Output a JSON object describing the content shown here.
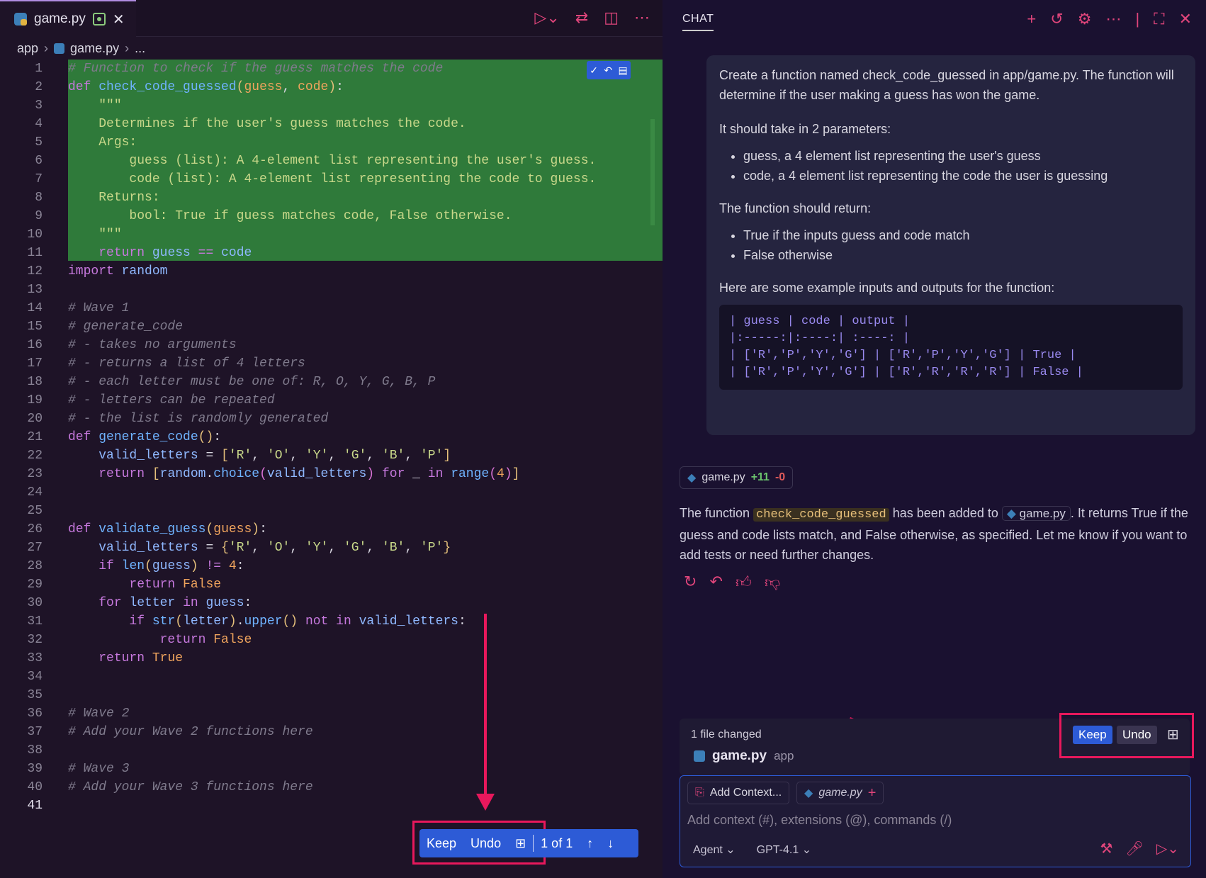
{
  "editor": {
    "tab_label": "game.py",
    "breadcrumb": [
      "app",
      "game.py",
      "..."
    ],
    "lines": [
      {
        "n": "1",
        "html": "<span class='cm'># Function to check if the guess matches the code</span>"
      },
      {
        "n": "2",
        "html": "<span class='kw'>def</span> <span class='fn'>check_code_guessed</span><span class='br'>(</span><span class='par'>guess</span>, <span class='par'>code</span><span class='br'>)</span>:"
      },
      {
        "n": "3",
        "html": "    <span class='doc'>\"\"\"</span>"
      },
      {
        "n": "4",
        "html": "    <span class='doc'>Determines if the user's guess matches the code.</span>"
      },
      {
        "n": "5",
        "html": "    <span class='doc'>Args:</span>"
      },
      {
        "n": "6",
        "html": "        <span class='doc'>guess (list): A 4-element list representing the user's guess.</span>"
      },
      {
        "n": "7",
        "html": "        <span class='doc'>code (list): A 4-element list representing the code to guess.</span>"
      },
      {
        "n": "8",
        "html": "    <span class='doc'>Returns:</span>"
      },
      {
        "n": "9",
        "html": "        <span class='doc'>bool: True if guess matches code, False otherwise.</span>"
      },
      {
        "n": "10",
        "html": "    <span class='doc'>\"\"\"</span>"
      },
      {
        "n": "11",
        "html": "    <span class='kw'>return</span> <span class='ident'>guess</span> <span class='kw'>==</span> <span class='ident'>code</span>"
      },
      {
        "n": "12",
        "html": "<span class='kw'>import</span> <span class='ident'>random</span>"
      },
      {
        "n": "13",
        "html": ""
      },
      {
        "n": "14",
        "html": "<span class='cm'># Wave 1</span>"
      },
      {
        "n": "15",
        "html": "<span class='cm'># generate_code</span>"
      },
      {
        "n": "16",
        "html": "<span class='cm'># - takes no arguments</span>"
      },
      {
        "n": "17",
        "html": "<span class='cm'># - returns a list of 4 letters</span>"
      },
      {
        "n": "18",
        "html": "<span class='cm'># - each letter must be one of: R, O, Y, G, B, P</span>"
      },
      {
        "n": "19",
        "html": "<span class='cm'># - letters can be repeated</span>"
      },
      {
        "n": "20",
        "html": "<span class='cm'># - the list is randomly generated</span>"
      },
      {
        "n": "21",
        "html": "<span class='kw'>def</span> <span class='fn'>generate_code</span><span class='br'>()</span>:"
      },
      {
        "n": "22",
        "html": "    <span class='ident'>valid_letters</span> = <span class='br'>[</span><span class='str'>'R'</span>, <span class='str'>'O'</span>, <span class='str'>'Y'</span>, <span class='str'>'G'</span>, <span class='str'>'B'</span>, <span class='str'>'P'</span><span class='br'>]</span>"
      },
      {
        "n": "23",
        "html": "    <span class='kw'>return</span> <span class='br'>[</span><span class='ident'>random</span>.<span class='fn'>choice</span><span class='br2'>(</span><span class='ident'>valid_letters</span><span class='br2'>)</span> <span class='kw'>for</span> _ <span class='kw'>in</span> <span class='fn'>range</span><span class='br2'>(</span><span class='num'>4</span><span class='br2'>)</span><span class='br'>]</span>"
      },
      {
        "n": "24",
        "html": ""
      },
      {
        "n": "25",
        "html": ""
      },
      {
        "n": "26",
        "html": "<span class='kw'>def</span> <span class='fn'>validate_guess</span><span class='br'>(</span><span class='par'>guess</span><span class='br'>)</span>:"
      },
      {
        "n": "27",
        "html": "    <span class='ident'>valid_letters</span> = <span class='br'>{</span><span class='str'>'R'</span>, <span class='str'>'O'</span>, <span class='str'>'Y'</span>, <span class='str'>'G'</span>, <span class='str'>'B'</span>, <span class='str'>'P'</span><span class='br'>}</span>"
      },
      {
        "n": "28",
        "html": "    <span class='kw'>if</span> <span class='fn'>len</span><span class='br'>(</span><span class='ident'>guess</span><span class='br'>)</span> <span class='kw'>!=</span> <span class='num'>4</span>:"
      },
      {
        "n": "29",
        "html": "        <span class='kw'>return</span> <span class='bool'>False</span>"
      },
      {
        "n": "30",
        "html": "    <span class='kw'>for</span> <span class='ident'>letter</span> <span class='kw'>in</span> <span class='ident'>guess</span>:"
      },
      {
        "n": "31",
        "html": "        <span class='kw'>if</span> <span class='fn'>str</span><span class='br'>(</span><span class='ident'>letter</span><span class='br'>)</span>.<span class='fn'>upper</span><span class='br'>()</span> <span class='kw'>not in</span> <span class='ident'>valid_letters</span>:"
      },
      {
        "n": "32",
        "html": "            <span class='kw'>return</span> <span class='bool'>False</span>"
      },
      {
        "n": "33",
        "html": "    <span class='kw'>return</span> <span class='bool'>True</span>"
      },
      {
        "n": "34",
        "html": ""
      },
      {
        "n": "35",
        "html": ""
      },
      {
        "n": "36",
        "html": "<span class='cm'># Wave 2</span>"
      },
      {
        "n": "37",
        "html": "<span class='cm'># Add your Wave 2 functions here</span>"
      },
      {
        "n": "38",
        "html": ""
      },
      {
        "n": "39",
        "html": "<span class='cm'># Wave 3</span>"
      },
      {
        "n": "40",
        "html": "<span class='cm'># Add your Wave 3 functions here</span>"
      },
      {
        "n": "41",
        "html": ""
      }
    ],
    "hunk": {
      "keep": "Keep",
      "undo": "Undo",
      "count": "1 of 1"
    }
  },
  "chat": {
    "tab": "CHAT",
    "user_msg": {
      "p1": "Create a function named check_code_guessed in app/game.py. The function will determine if the user making a guess has won the game.",
      "p2": "It should take in 2 parameters:",
      "b1": "guess, a 4 element list representing the user's guess",
      "b2": "code, a 4 element list representing the code the user is guessing",
      "p3": "The function should return:",
      "b3": "True if the inputs guess and code match",
      "b4": "False otherwise",
      "p4": "Here are some example inputs and outputs for the function:",
      "code": "| guess | code | output |\n|:-----:|:----:| :----: |\n| ['R','P','Y','G'] | ['R','P','Y','G'] | True |\n| ['R','P','Y','G'] | ['R','R','R','R'] | False |"
    },
    "file_chip": {
      "name": "game.py",
      "added": "+11",
      "removed": "-0"
    },
    "reply": {
      "a": "The function ",
      "code": "check_code_guessed",
      "b": " has been added to ",
      "file": "game.py",
      "c": ". It returns True if the guess and code lists match, and False otherwise, as specified. Let me know if you want to add tests or need further changes."
    },
    "changed": {
      "title": "1 file changed",
      "file": "game.py",
      "dir": "app",
      "keep": "Keep",
      "undo": "Undo"
    },
    "input": {
      "add_context": "Add Context...",
      "ctx_file": "game.py",
      "placeholder": "Add context (#), extensions (@), commands (/)",
      "mode": "Agent",
      "model": "GPT-4.1"
    }
  }
}
